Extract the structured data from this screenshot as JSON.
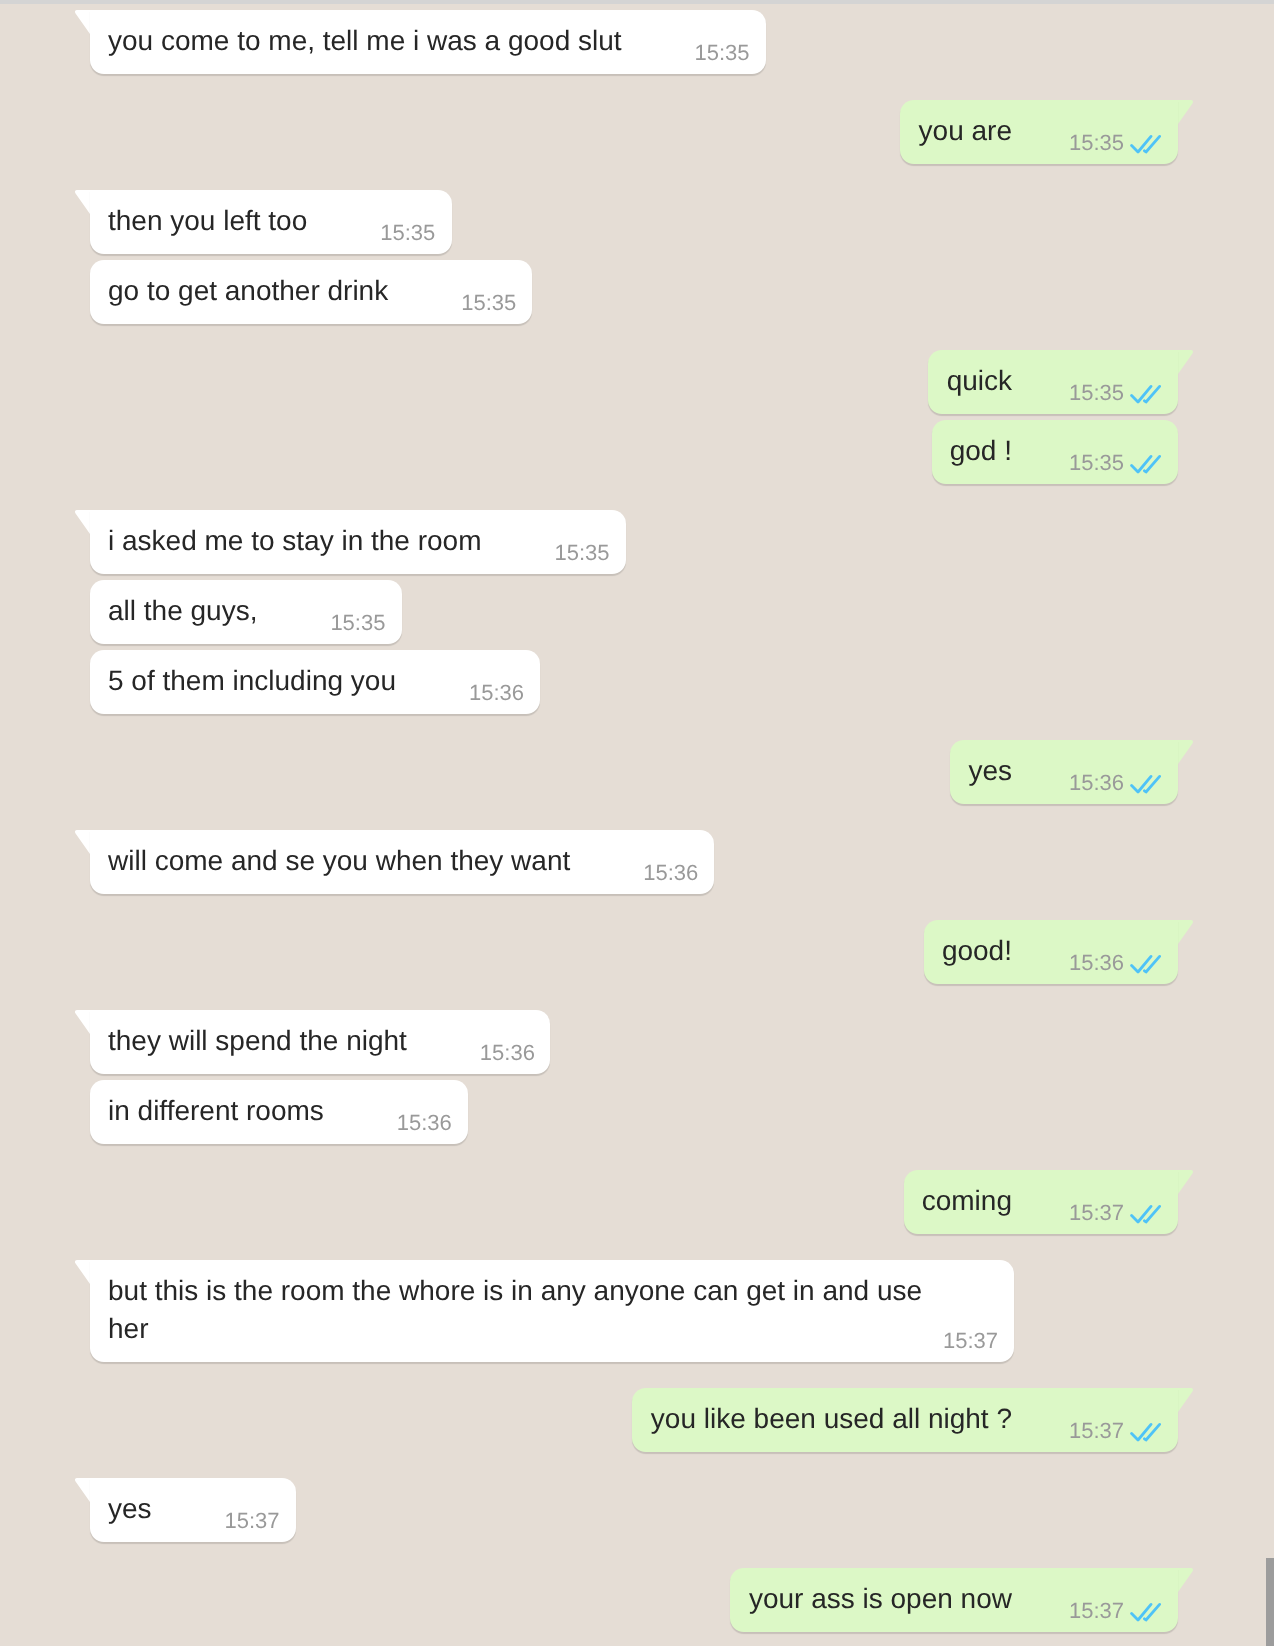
{
  "chat": {
    "messages": [
      {
        "outgoing": false,
        "text": "you come to me, tell me i was a good slut",
        "time": "15:35"
      },
      {
        "outgoing": true,
        "text": "you are",
        "time": "15:35",
        "read": true
      },
      {
        "outgoing": false,
        "text": "then you left too",
        "time": "15:35"
      },
      {
        "outgoing": false,
        "text": "go to get another drink",
        "time": "15:35"
      },
      {
        "outgoing": true,
        "text": "quick",
        "time": "15:35",
        "read": true
      },
      {
        "outgoing": true,
        "text": "god !",
        "time": "15:35",
        "read": true
      },
      {
        "outgoing": false,
        "text": "i asked me to stay in the room",
        "time": "15:35"
      },
      {
        "outgoing": false,
        "text": "all the guys,",
        "time": "15:35"
      },
      {
        "outgoing": false,
        "text": "5 of them including you",
        "time": "15:36"
      },
      {
        "outgoing": true,
        "text": "yes",
        "time": "15:36",
        "read": true
      },
      {
        "outgoing": false,
        "text": "will come and se you when they want",
        "time": "15:36"
      },
      {
        "outgoing": true,
        "text": "good!",
        "time": "15:36",
        "read": true
      },
      {
        "outgoing": false,
        "text": "they will spend the night",
        "time": "15:36"
      },
      {
        "outgoing": false,
        "text": "in different rooms",
        "time": "15:36"
      },
      {
        "outgoing": true,
        "text": "coming",
        "time": "15:37",
        "read": true
      },
      {
        "outgoing": false,
        "text": "but this is the room the whore is in any anyone can get in and use her",
        "time": "15:37"
      },
      {
        "outgoing": true,
        "text": "you like been used all night ?",
        "time": "15:37",
        "read": true
      },
      {
        "outgoing": false,
        "text": "yes",
        "time": "15:37"
      },
      {
        "outgoing": true,
        "text": "your ass is open now",
        "time": "15:37",
        "read": true
      }
    ]
  }
}
